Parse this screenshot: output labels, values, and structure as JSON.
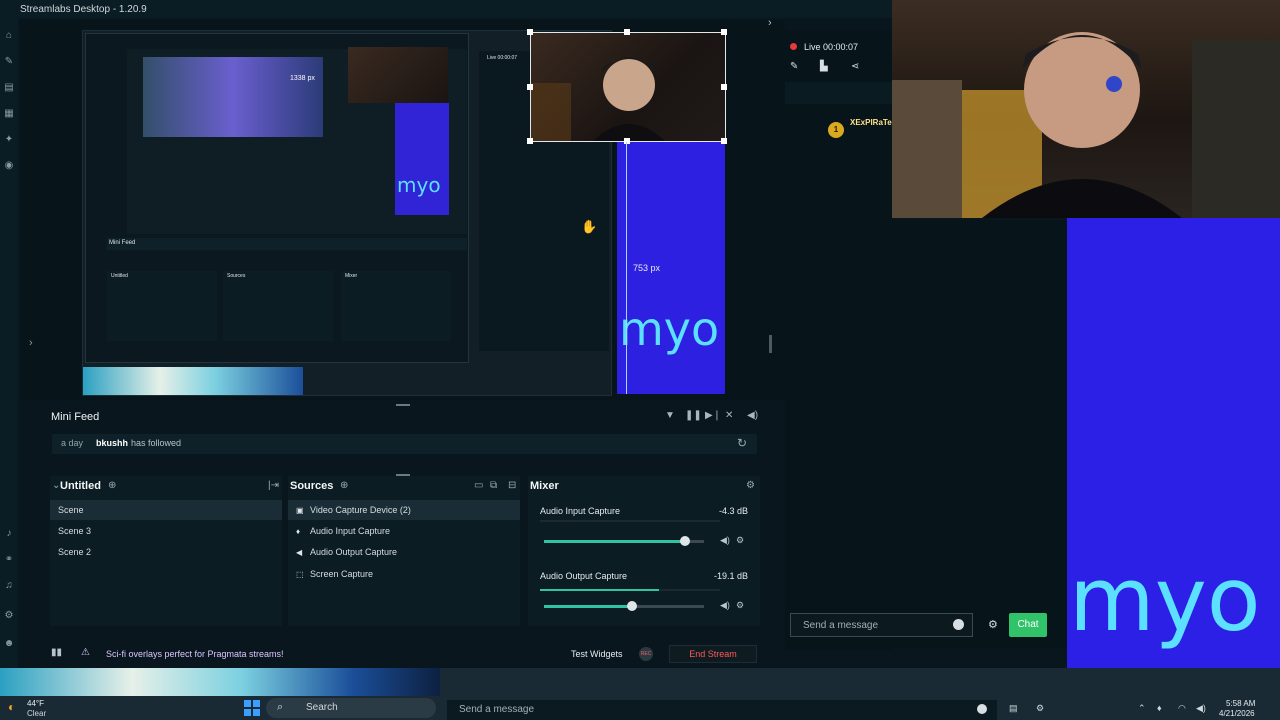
{
  "window": {
    "title": "Streamlabs Desktop - 1.20.9"
  },
  "preview": {
    "width_label": "753 px",
    "nested_label": "1338 px",
    "nested_minifeed": "Mini Feed",
    "nested_scenes": "Untitled",
    "nested_sources": "Sources",
    "nested_mixer": "Mixer",
    "nested_live": "Live 00:00:07",
    "script_text": "myo"
  },
  "minifeed": {
    "title": "Mini Feed",
    "event": {
      "time": "a day",
      "user": "bkushh",
      "action": "has followed"
    }
  },
  "scenes": {
    "title": "Untitled",
    "items": [
      "Scene",
      "Scene 3",
      "Scene 2"
    ]
  },
  "sources": {
    "title": "Sources",
    "items": [
      "Video Capture Device (2)",
      "Audio Input Capture",
      "Audio Output Capture",
      "Screen Capture"
    ]
  },
  "mixer": {
    "title": "Mixer",
    "channels": [
      {
        "name": "Audio Input Capture",
        "db": "-4.3 dB",
        "level": 0.88
      },
      {
        "name": "Audio Output Capture",
        "db": "-19.1 dB",
        "level": 0.55
      }
    ]
  },
  "bottom": {
    "promo": "Sci-fi overlays perfect for Pragmata streams!",
    "test_widgets": "Test Widgets",
    "rec": "REC",
    "end_stream": "End Stream"
  },
  "chat": {
    "live_status": "Live 00:00:07",
    "user": "XExPIRaTe",
    "badge": "1",
    "input_placeholder": "Send a message",
    "send_label": "Chat"
  },
  "overlay": {
    "script_text": "myo"
  },
  "taskbar": {
    "weather_temp": "44°F",
    "weather_cond": "Clear",
    "search_placeholder": "Search",
    "stream_chat_placeholder": "Send a message",
    "time": "5:58 AM",
    "date": "4/21/2026"
  },
  "colors": {
    "accent": "#31c3a2",
    "live": "#e83a3a",
    "end_stream": "#ff5a5a",
    "chat_button": "#31c36a",
    "blue_canvas": "#2c1fe6"
  }
}
